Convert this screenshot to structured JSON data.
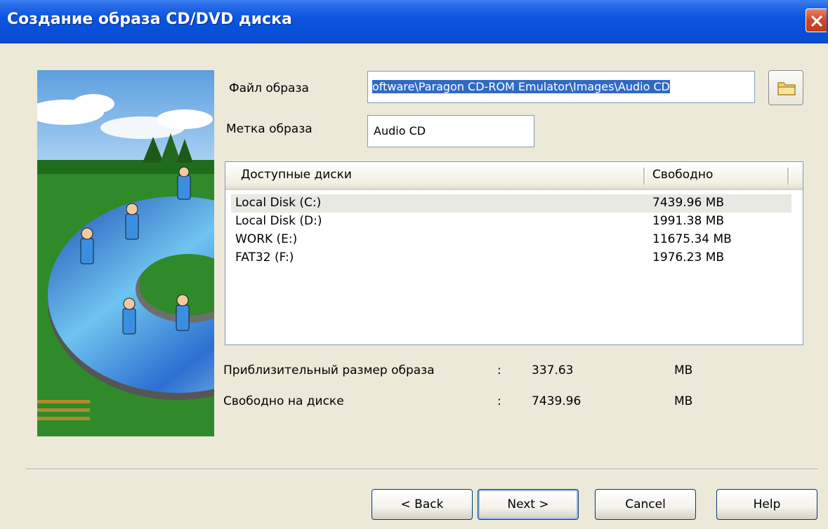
{
  "window": {
    "title": "Создание образа CD/DVD диска"
  },
  "form": {
    "image_file_label": "Файл образа",
    "image_file_value": "oftware\\Paragon CD-ROM Emulator\\Images\\Audio CD",
    "image_label_label": "Метка образа",
    "image_label_value": "Audio CD"
  },
  "drives": {
    "columns": [
      "Доступные диски",
      "Свободно"
    ],
    "rows": [
      {
        "name": "Local Disk (C:)",
        "free": "7439.96 MB",
        "selected": true
      },
      {
        "name": "Local Disk (D:)",
        "free": "1991.38 MB",
        "selected": false
      },
      {
        "name": "WORK (E:)",
        "free": "11675.34 MB",
        "selected": false
      },
      {
        "name": "FAT32 (F:)",
        "free": "1976.23 MB",
        "selected": false
      }
    ]
  },
  "info": {
    "approx_size_label": "Приблизительный размер образа",
    "approx_size_sep": ":",
    "approx_size_value": "337.63",
    "approx_size_unit": "MB",
    "free_on_disk_label": "Свободно на диске",
    "free_on_disk_sep": ":",
    "free_on_disk_value": "7439.96",
    "free_on_disk_unit": "MB"
  },
  "buttons": {
    "back": "< Back",
    "next": "Next >",
    "cancel": "Cancel",
    "help": "Help"
  },
  "icons": {
    "close": "close-icon",
    "browse": "folder-icon"
  },
  "colors": {
    "titlebar": "#0a55e1",
    "selection": "#316ac5",
    "dialog_bg": "#ece9d8"
  }
}
